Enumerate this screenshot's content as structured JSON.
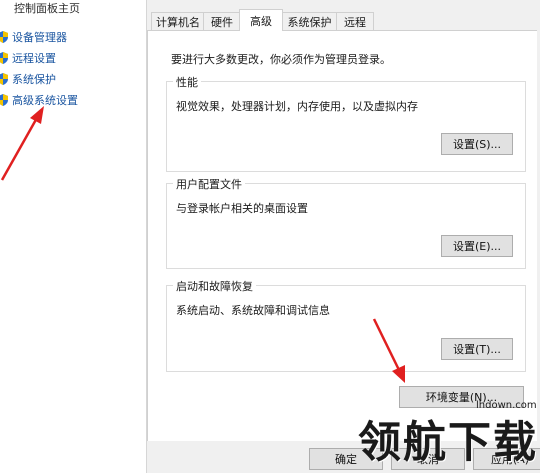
{
  "sidebar": {
    "home": "控制面板主页",
    "items": [
      {
        "label": "设备管理器"
      },
      {
        "label": "远程设置"
      },
      {
        "label": "系统保护"
      },
      {
        "label": "高级系统设置"
      }
    ]
  },
  "dialog": {
    "tabs": [
      "计算机名",
      "硬件",
      "高级",
      "系统保护",
      "远程"
    ],
    "active_tab": "高级",
    "admin_note": "要进行大多数更改，你必须作为管理员登录。",
    "groups": [
      {
        "title": "性能",
        "desc": "视觉效果，处理器计划，内存使用，以及虚拟内存",
        "button": "设置(S)..."
      },
      {
        "title": "用户配置文件",
        "desc": "与登录帐户相关的桌面设置",
        "button": "设置(E)..."
      },
      {
        "title": "启动和故障恢复",
        "desc": "系统启动、系统故障和调试信息",
        "button": "设置(T)..."
      }
    ],
    "env_button": "环境变量(N)...",
    "footer": {
      "ok": "确定",
      "cancel": "取消",
      "apply": "应用(A)"
    }
  },
  "watermark": {
    "text": "领航下载",
    "url": "lhdown.com"
  },
  "colors": {
    "link": "#1a55a0",
    "annotation_arrow": "#e02020",
    "shield_blue": "#2a6fd0",
    "shield_yellow": "#f5c400"
  }
}
